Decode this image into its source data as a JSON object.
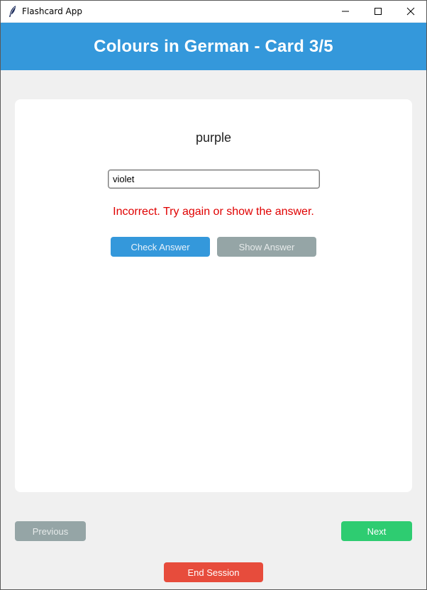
{
  "window": {
    "title": "Flashcard App",
    "icon": "feather-icon"
  },
  "header": {
    "title": "Colours in German - Card 3/5"
  },
  "card": {
    "word": "purple",
    "answer_value": "violet",
    "feedback": "Incorrect. Try again or show the answer.",
    "check_label": "Check Answer",
    "show_label": "Show Answer"
  },
  "nav": {
    "previous_label": "Previous",
    "next_label": "Next",
    "end_label": "End Session"
  },
  "colors": {
    "header": "#3498db",
    "check": "#3498db",
    "show": "#95a5a6",
    "previous": "#95a5a6",
    "next": "#2ecc71",
    "end": "#e74c3c",
    "feedback": "#e00000"
  }
}
